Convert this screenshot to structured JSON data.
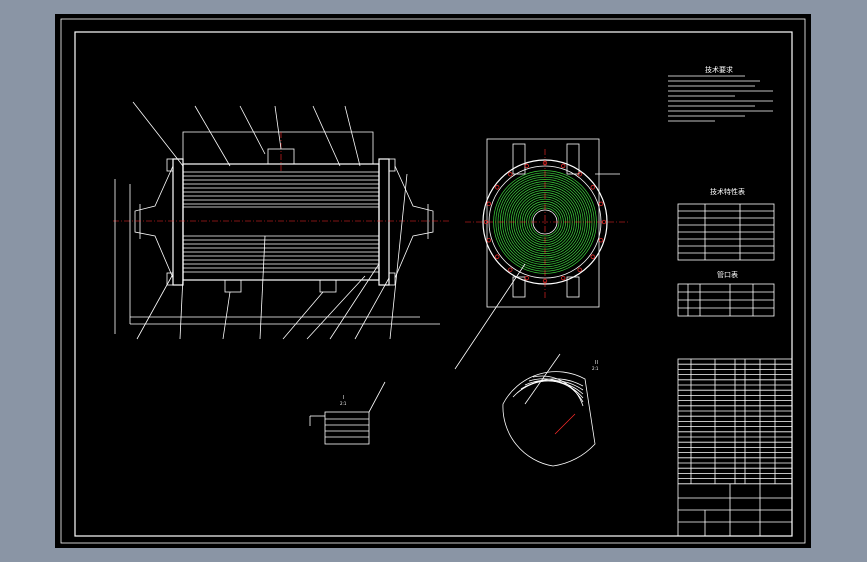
{
  "drawing": {
    "notes_title": "技术要求",
    "spec_table_title": "技术特性表",
    "nozzle_table_title": "管口表",
    "section_label_1": "I",
    "section_label_1_scale": "2:1",
    "section_label_2": "II",
    "section_label_2_scale": "2:1"
  },
  "colors": {
    "background": "#000000",
    "line": "#ffffff",
    "center_line": "#ff2a2a",
    "coil": "#3dd43d",
    "frame_surround": "#8a95a5"
  }
}
